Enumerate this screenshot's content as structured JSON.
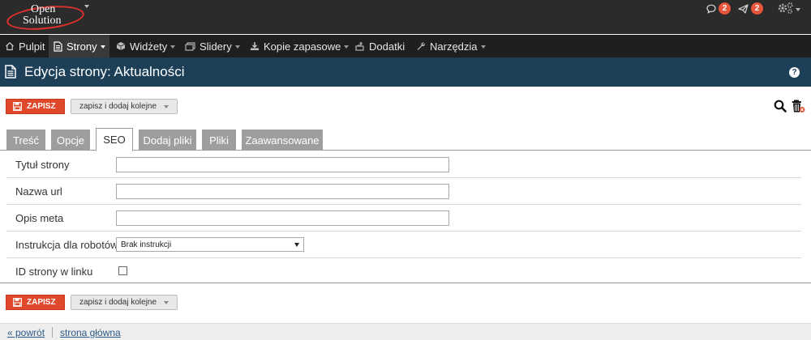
{
  "app": {
    "logo_line1": "Open",
    "logo_line2": "Solution"
  },
  "notifications": {
    "comments_count": "2",
    "messages_count": "2"
  },
  "menu": {
    "items": [
      {
        "label": "Pulpit",
        "icon": "home-icon",
        "has_caret": false
      },
      {
        "label": "Strony",
        "icon": "page-icon",
        "has_caret": true,
        "active": true
      },
      {
        "label": "Widżety",
        "icon": "cube-icon",
        "has_caret": true
      },
      {
        "label": "Slidery",
        "icon": "slides-icon",
        "has_caret": true
      },
      {
        "label": "Kopie zapasowe",
        "icon": "download-icon",
        "has_caret": true
      },
      {
        "label": "Dodatki",
        "icon": "puzzle-icon",
        "has_caret": false
      },
      {
        "label": "Narzędzia",
        "icon": "wrench-icon",
        "has_caret": true
      }
    ]
  },
  "page": {
    "title": "Edycja strony: Aktualności",
    "help": "?"
  },
  "toolbar": {
    "save_label": "ZAPISZ",
    "save_add_label": "zapisz i dodaj kolejne"
  },
  "tabs": [
    {
      "label": "Treść"
    },
    {
      "label": "Opcje"
    },
    {
      "label": "SEO",
      "active": true
    },
    {
      "label": "Dodaj pliki"
    },
    {
      "label": "Pliki"
    },
    {
      "label": "Zaawansowane"
    }
  ],
  "form": {
    "page_title_label": "Tytuł strony",
    "page_title_value": "",
    "url_name_label": "Nazwa url",
    "url_name_value": "",
    "meta_desc_label": "Opis meta",
    "meta_desc_value": "",
    "robots_label": "Instrukcja dla robotów",
    "robots_value": "Brak instrukcji",
    "id_in_link_label": "ID strony w linku",
    "id_in_link_checked": false
  },
  "footer": {
    "back_label": "« powrót",
    "home_label": "strona główna"
  },
  "colors": {
    "accent_red": "#e0482b",
    "title_bar": "#1d3f57",
    "menu_bg": "#1f1f1f",
    "badge": "#e7553b"
  }
}
